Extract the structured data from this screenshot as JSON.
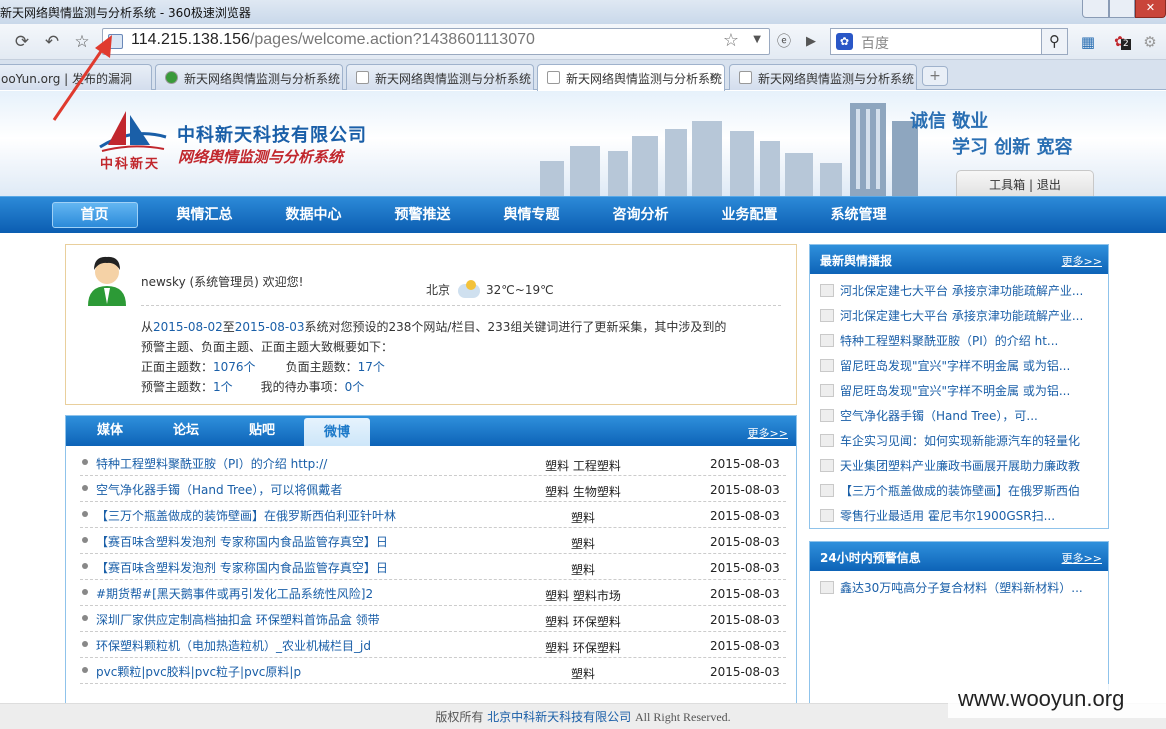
{
  "window": {
    "title": "新天网络舆情监测与分析系统 - 360极速浏览器"
  },
  "browser": {
    "url_host": "114.215.138.156",
    "url_path": "/pages/welcome.action?1438601113070",
    "search_placeholder": "百度",
    "badge": "2",
    "tabs": [
      {
        "label": "ooYun.org | 发布的漏洞"
      },
      {
        "label": "新天网络舆情监测与分析系统"
      },
      {
        "label": "新天网络舆情监测与分析系统"
      },
      {
        "label": "新天网络舆情监测与分析系统"
      },
      {
        "label": "新天网络舆情监测与分析系统"
      }
    ]
  },
  "banner": {
    "logo_text": "中科新天",
    "company": "中科新天科技有限公司",
    "system": "网络舆情监测与分析系统",
    "slogan1": "诚信 敬业",
    "slogan2": "学习 创新 宽容",
    "tools": "工具箱 | 退出"
  },
  "nav": [
    "首页",
    "舆情汇总",
    "数据中心",
    "预警推送",
    "舆情专题",
    "咨询分析",
    "业务配置",
    "系统管理"
  ],
  "welcome": {
    "greeting": "newsky (系统管理员) 欢迎您!",
    "city": "北京",
    "temp": "32℃~19℃",
    "from": "从",
    "date_from": "2015-08-02",
    "to": "至",
    "date_to": "2015-08-03",
    "summary_a": "系统对您预设的238个网站/栏目、233组关键词进行了更新采集，其中涉及到的",
    "summary_b": "预警主题、负面主题、正面主题大致概要如下：",
    "pos_label": "正面主题数：",
    "pos_val": "1076个",
    "neg_label": "负面主题数：",
    "neg_val": "17个",
    "warn_label": "预警主题数：",
    "warn_val": "1个",
    "todo_label": "我的待办事项：",
    "todo_val": "0个"
  },
  "media": {
    "tabs": [
      "媒体",
      "论坛",
      "贴吧",
      "微博"
    ],
    "more": "更多>>",
    "rows": [
      {
        "title": "特种工程塑料聚酰亚胺（PI）的介绍 http://",
        "kw": "塑料 工程塑料",
        "date": "2015-08-03"
      },
      {
        "title": "空气净化器手镯（Hand Tree），可以将佩戴者",
        "kw": "塑料 生物塑料",
        "date": "2015-08-03"
      },
      {
        "title": "【三万个瓶盖做成的装饰壁画】在俄罗斯西伯利亚针叶林",
        "kw": "塑料",
        "date": "2015-08-03"
      },
      {
        "title": "【赛百味含塑料发泡剂 专家称国内食品监管存真空】日",
        "kw": "塑料",
        "date": "2015-08-03"
      },
      {
        "title": "【赛百味含塑料发泡剂 专家称国内食品监管存真空】日",
        "kw": "塑料",
        "date": "2015-08-03"
      },
      {
        "title": "#期货帮#[黑天鹅事件或再引发化工品系统性风险]2",
        "kw": "塑料 塑料市场",
        "date": "2015-08-03"
      },
      {
        "title": "深圳厂家供应定制高档抽扣盒 环保塑料首饰品盒 领带",
        "kw": "塑料 环保塑料",
        "date": "2015-08-03"
      },
      {
        "title": "环保塑料颗粒机（电加热造粒机）_农业机械栏目_jd",
        "kw": "塑料 环保塑料",
        "date": "2015-08-03"
      },
      {
        "title": "pvc颗粒|pvc胶料|pvc粒子|pvc原料|p",
        "kw": "塑料",
        "date": "2015-08-03"
      }
    ]
  },
  "latest": {
    "title": "最新舆情播报",
    "more": "更多>>",
    "items": [
      "河北保定建七大平台 承接京津功能疏解产业...",
      "河北保定建七大平台 承接京津功能疏解产业...",
      "特种工程塑料聚酰亚胺（PI）的介绍 ht...",
      "留尼旺岛发现\"宜兴\"字样不明金属 或为铝...",
      "留尼旺岛发现\"宜兴\"字样不明金属 或为铝...",
      "空气净化器手镯（Hand Tree），可...",
      "车企实习见闻：如何实现新能源汽车的轻量化",
      "天业集团塑料产业廉政书画展开展助力廉政教",
      "【三万个瓶盖做成的装饰壁画】在俄罗斯西伯",
      "零售行业最适用 霍尼韦尔1900GSR扫..."
    ]
  },
  "alerts": {
    "title": "24小时内预警信息",
    "more": "更多>>",
    "items": [
      "鑫达30万吨高分子复合材料（塑料新材料）..."
    ]
  },
  "footer": {
    "prefix": "版权所有",
    "org": "北京中科新天科技有限公司",
    "rights": "All Right Reserved."
  },
  "watermark": "www.wooyun.org"
}
